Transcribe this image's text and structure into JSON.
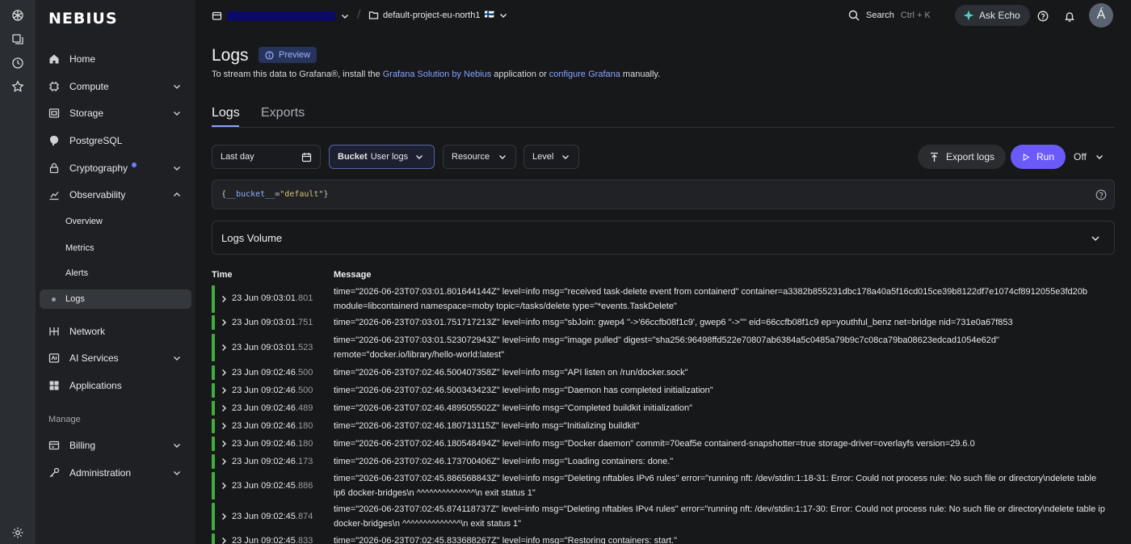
{
  "brand": {
    "logo_text": "NEBIUS"
  },
  "header": {
    "project_name": "default-project-eu-north1",
    "project_flag": "🇫🇮",
    "search_label": "Search",
    "search_shortcut": "Ctrl + K",
    "ask_echo_label": "Ask Echo",
    "avatar_initial": "Á"
  },
  "sidebar": {
    "items": [
      {
        "label": "Home"
      },
      {
        "label": "Compute"
      },
      {
        "label": "Storage"
      },
      {
        "label": "PostgreSQL"
      },
      {
        "label": "Cryptography"
      },
      {
        "label": "Observability"
      },
      {
        "label": "Network"
      },
      {
        "label": "AI Services"
      },
      {
        "label": "Applications"
      }
    ],
    "observability_children": [
      {
        "label": "Overview"
      },
      {
        "label": "Metrics"
      },
      {
        "label": "Alerts"
      },
      {
        "label": "Logs"
      }
    ],
    "manage_heading": "Manage",
    "manage_items": [
      {
        "label": "Billing"
      },
      {
        "label": "Administration"
      }
    ]
  },
  "page": {
    "title": "Logs",
    "badge": "Preview",
    "subtitle_prefix": "To stream this data to Grafana®, install the ",
    "subtitle_link1": "Grafana Solution by Nebius",
    "subtitle_middle": " application or ",
    "subtitle_link2": "configure Grafana",
    "subtitle_suffix": " manually."
  },
  "tabs": [
    {
      "label": "Logs",
      "active": true
    },
    {
      "label": "Exports",
      "active": false
    }
  ],
  "filters": {
    "time_range": "Last day",
    "bucket_label": "Bucket",
    "bucket_value": "User logs",
    "resource": "Resource",
    "level": "Level",
    "export_label": "Export logs",
    "run_label": "Run",
    "refresh_value": "Off"
  },
  "query": {
    "open": "{",
    "key": "__bucket__",
    "op": "=",
    "value": "\"default\"",
    "close": "}"
  },
  "volume": {
    "title": "Logs Volume"
  },
  "table": {
    "headers": {
      "time": "Time",
      "message": "Message"
    },
    "rows": [
      {
        "time": "23 Jun 09:03:01",
        "ms": ".801",
        "message": "time=\"2026-06-23T07:03:01.801644144Z\" level=info msg=\"received task-delete event from containerd\" container=a3382b855231dbc178a40a5f16cd015ce39b8122df7e1074cf8912055e3fd20b module=libcontainerd namespace=moby topic=/tasks/delete type=\"*events.TaskDelete\""
      },
      {
        "time": "23 Jun 09:03:01",
        "ms": ".751",
        "message": "time=\"2026-06-23T07:03:01.751717213Z\" level=info msg=\"sbJoin: gwep4 ''->'66ccfb08f1c9', gwep6 ''->''\" eid=66ccfb08f1c9 ep=youthful_benz net=bridge nid=731e0a67f853"
      },
      {
        "time": "23 Jun 09:03:01",
        "ms": ".523",
        "message": "time=\"2026-06-23T07:03:01.523072943Z\" level=info msg=\"image pulled\" digest=\"sha256:96498ffd522e70807ab6384a5c0485a79b9c7c08ca79ba08623edcad1054e62d\" remote=\"docker.io/library/hello-world:latest\""
      },
      {
        "time": "23 Jun 09:02:46",
        "ms": ".500",
        "message": "time=\"2026-06-23T07:02:46.500407358Z\" level=info msg=\"API listen on /run/docker.sock\""
      },
      {
        "time": "23 Jun 09:02:46",
        "ms": ".500",
        "message": "time=\"2026-06-23T07:02:46.500343423Z\" level=info msg=\"Daemon has completed initialization\""
      },
      {
        "time": "23 Jun 09:02:46",
        "ms": ".489",
        "message": "time=\"2026-06-23T07:02:46.489505502Z\" level=info msg=\"Completed buildkit initialization\""
      },
      {
        "time": "23 Jun 09:02:46",
        "ms": ".180",
        "message": "time=\"2026-06-23T07:02:46.180713115Z\" level=info msg=\"Initializing buildkit\""
      },
      {
        "time": "23 Jun 09:02:46",
        "ms": ".180",
        "message": "time=\"2026-06-23T07:02:46.180548494Z\" level=info msg=\"Docker daemon\" commit=70eaf5e containerd-snapshotter=true storage-driver=overlayfs version=29.6.0"
      },
      {
        "time": "23 Jun 09:02:46",
        "ms": ".173",
        "message": "time=\"2026-06-23T07:02:46.173700406Z\" level=info msg=\"Loading containers: done.\""
      },
      {
        "time": "23 Jun 09:02:45",
        "ms": ".886",
        "message": "time=\"2026-06-23T07:02:45.886568843Z\" level=info msg=\"Deleting nftables IPv6 rules\" error=\"running nft: /dev/stdin:1:18-31: Error: Could not process rule: No such file or directory\\ndelete table ip6 docker-bridges\\n ^^^^^^^^^^^^^^\\n exit status 1\""
      },
      {
        "time": "23 Jun 09:02:45",
        "ms": ".874",
        "message": "time=\"2026-06-23T07:02:45.874118737Z\" level=info msg=\"Deleting nftables IPv4 rules\" error=\"running nft: /dev/stdin:1:17-30: Error: Could not process rule: No such file or directory\\ndelete table ip docker-bridges\\n ^^^^^^^^^^^^^^\\n exit status 1\""
      },
      {
        "time": "23 Jun 09:02:45",
        "ms": ".833",
        "message": "time=\"2026-06-23T07:02:45.833688267Z\" level=info msg=\"Restoring containers: start.\""
      }
    ]
  }
}
